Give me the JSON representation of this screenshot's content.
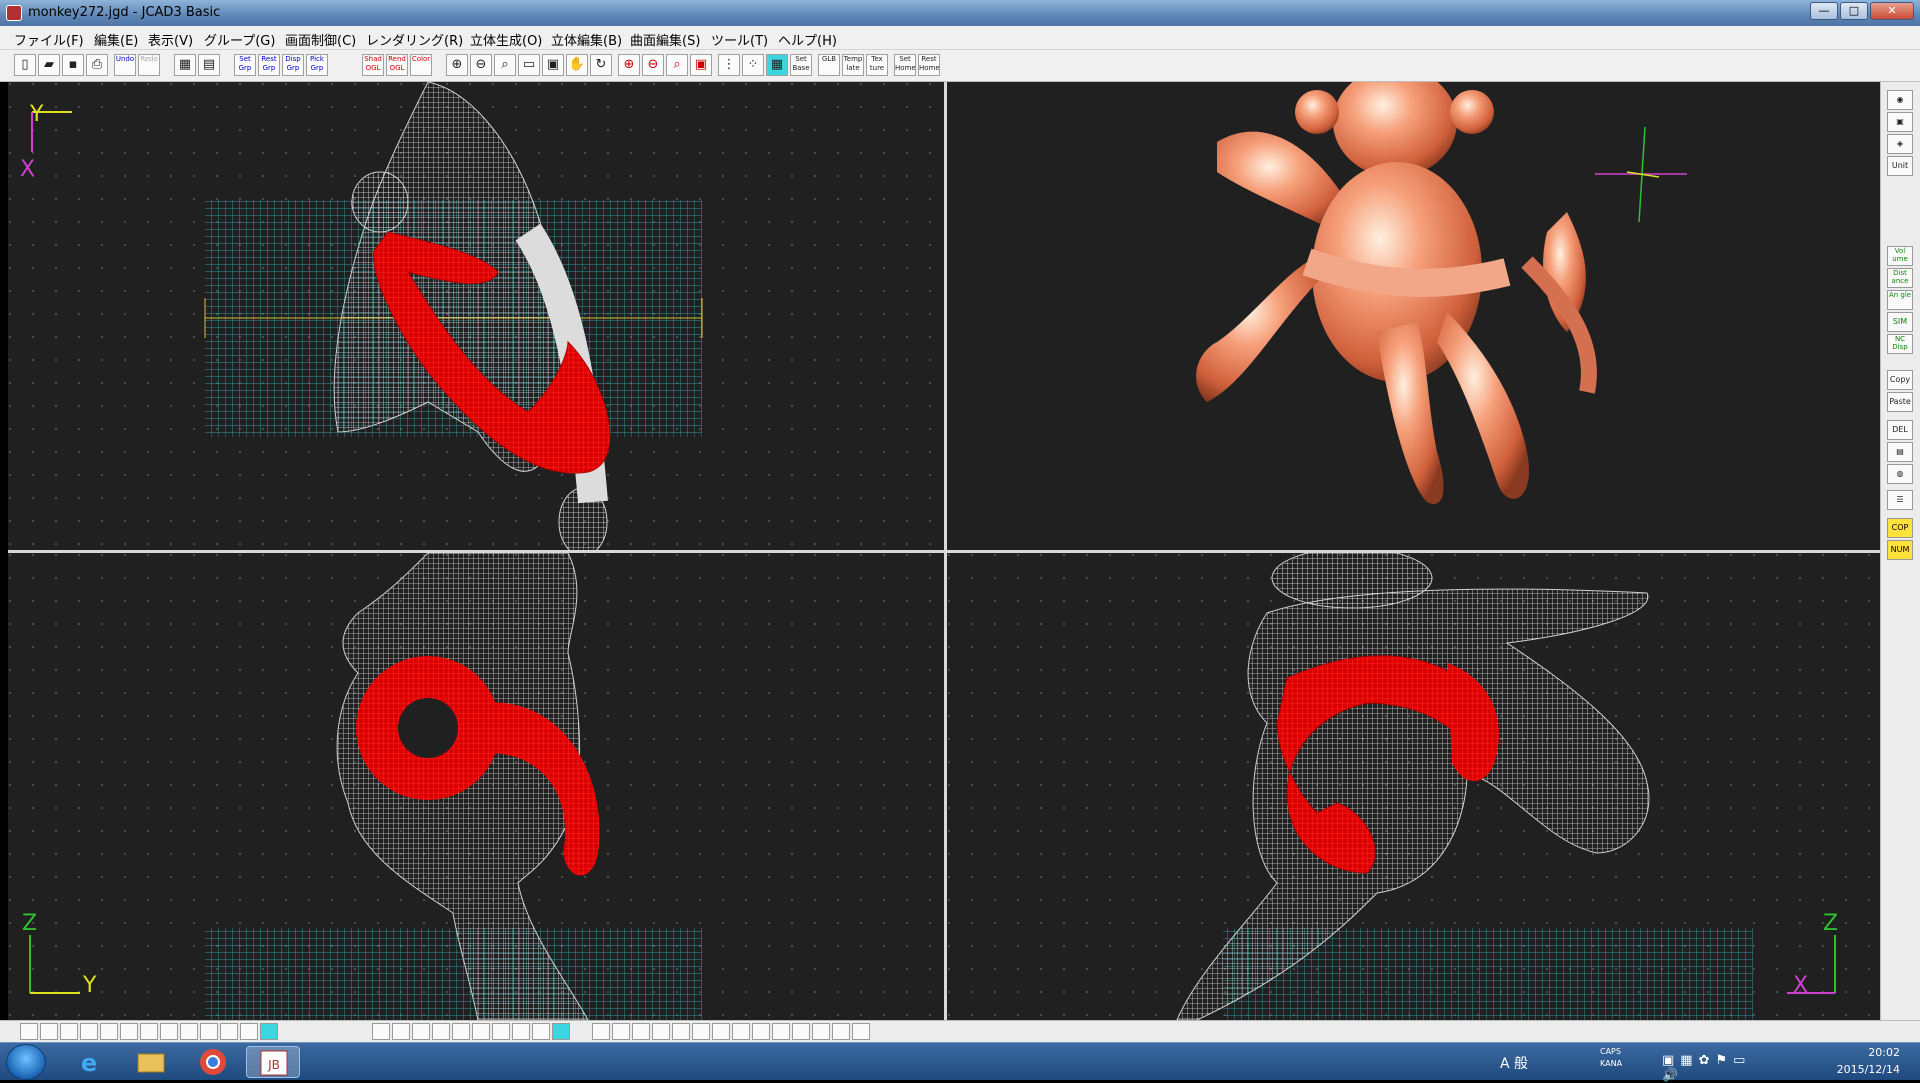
{
  "window": {
    "title": "monkey272.jgd - JCAD3 Basic",
    "controls": [
      "—",
      "□",
      "✕"
    ]
  },
  "menu": [
    "ファイル(F)",
    "編集(E)",
    "表示(V)",
    "グループ(G)",
    "画面制御(C)",
    "レンダリング(R)",
    "立体生成(O)",
    "立体編集(B)",
    "曲面編集(S)",
    "ツール(T)",
    "ヘルプ(H)"
  ],
  "toolbar": {
    "undo": "Undo",
    "redo": "Redo",
    "set_grp": "Set Grp",
    "rest_grp": "Rest Grp",
    "disp_grp": "Disp Grp",
    "pick_grp": "Pick Grp",
    "shad_ogl": "Shad OGL",
    "rend_ogl": "Rend OGL",
    "color": "Color",
    "set_base": "Set Base",
    "glb": "GLB",
    "template": "Temp late",
    "texture": "Tex ture",
    "set_home": "Set Home",
    "rest_home": "Rest Home"
  },
  "viewports": {
    "top": {
      "axis_v": "Y",
      "axis_h": "X"
    },
    "front": {
      "axis_v": "Z",
      "axis_h": "Y"
    },
    "side": {
      "axis_v": "Z",
      "axis_h": "X"
    }
  },
  "side_panel": {
    "unit": "Unit",
    "volume": "Vol ume",
    "distance": "Dist ance",
    "angle": "An gle",
    "sim": "SIM",
    "nc_disp": "NC Disp",
    "copy": "Copy",
    "paste": "Paste",
    "del": "DEL",
    "cop": "COP",
    "num": "NUM"
  },
  "taskbar": {
    "time": "20:02",
    "date": "2015/12/14",
    "ime": "A 般",
    "caps": "CAPS",
    "kana": "KANA"
  },
  "colors": {
    "viewport_bg": "#202020",
    "grid": "#3ab8c8",
    "wireframe": "#d9d9d9",
    "selected": "#e01010",
    "render": "#f2956c",
    "axis_y": "#e0e020",
    "axis_x": "#d040d0",
    "axis_z": "#30c030"
  }
}
